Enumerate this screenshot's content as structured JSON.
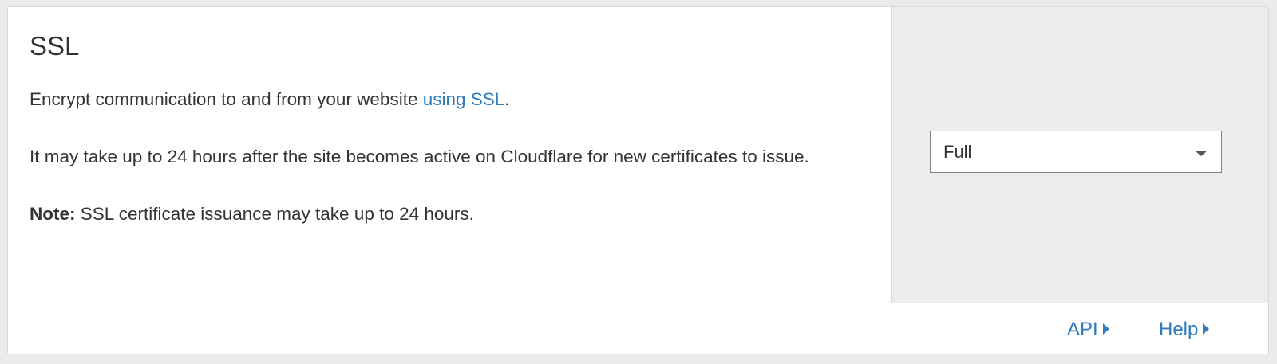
{
  "card": {
    "title": "SSL",
    "description_prefix": "Encrypt communication to and from your website ",
    "description_link": "using SSL",
    "description_suffix": ".",
    "issuance_text": "It may take up to 24 hours after the site becomes active on Cloudflare for new certificates to issue.",
    "note_label": "Note:",
    "note_text": " SSL certificate issuance may take up to 24 hours."
  },
  "ssl_mode_select": {
    "value": "Full",
    "icon": "chevron-down-icon"
  },
  "footer": {
    "api_label": "API",
    "help_label": "Help",
    "link_icon": "caret-right-icon"
  },
  "colors": {
    "link": "#2f7bbf",
    "text": "#333333",
    "panel_background": "#ececec",
    "card_background": "#ffffff",
    "border": "#d9d9d9"
  }
}
